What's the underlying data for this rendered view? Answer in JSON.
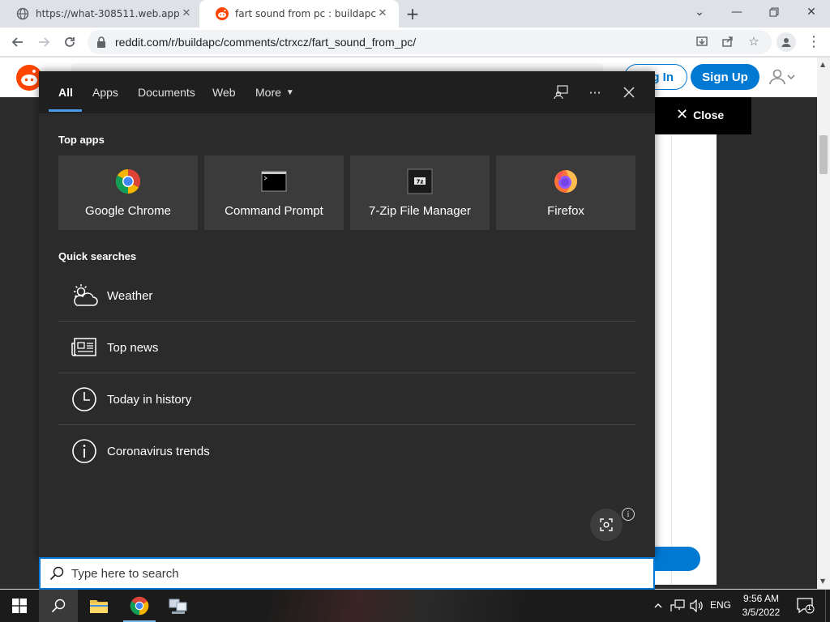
{
  "browser": {
    "tabs": [
      {
        "title": "https://what-308511.web.app",
        "favicon": "globe-icon"
      },
      {
        "title": "fart sound from pc : buildapc",
        "favicon": "reddit-icon"
      }
    ],
    "new_tab": "+",
    "url": "reddit.com/r/buildapc/comments/ctrxcz/fart_sound_from_pc/"
  },
  "reddit": {
    "login_label": "Log In",
    "signup_label": "Sign Up",
    "close_label": "Close"
  },
  "search_panel": {
    "tabs": [
      {
        "label": "All"
      },
      {
        "label": "Apps"
      },
      {
        "label": "Documents"
      },
      {
        "label": "Web"
      },
      {
        "label": "More"
      }
    ],
    "top_apps_heading": "Top apps",
    "top_apps": [
      {
        "label": "Google Chrome",
        "icon": "chrome-icon"
      },
      {
        "label": "Command Prompt",
        "icon": "command-prompt-icon"
      },
      {
        "label": "7-Zip File Manager",
        "icon": "7zip-icon"
      },
      {
        "label": "Firefox",
        "icon": "firefox-icon"
      }
    ],
    "quick_searches_heading": "Quick searches",
    "quick_searches": [
      {
        "label": "Weather",
        "icon": "weather-icon"
      },
      {
        "label": "Top news",
        "icon": "news-icon"
      },
      {
        "label": "Today in history",
        "icon": "clock-icon"
      },
      {
        "label": "Coronavirus trends",
        "icon": "info-icon"
      }
    ],
    "search_placeholder": "Type here to search",
    "accent_color": "#0078d7"
  },
  "taskbar": {
    "language": "ENG",
    "time": "9:56 AM",
    "date": "3/5/2022",
    "notification_count": "1"
  }
}
